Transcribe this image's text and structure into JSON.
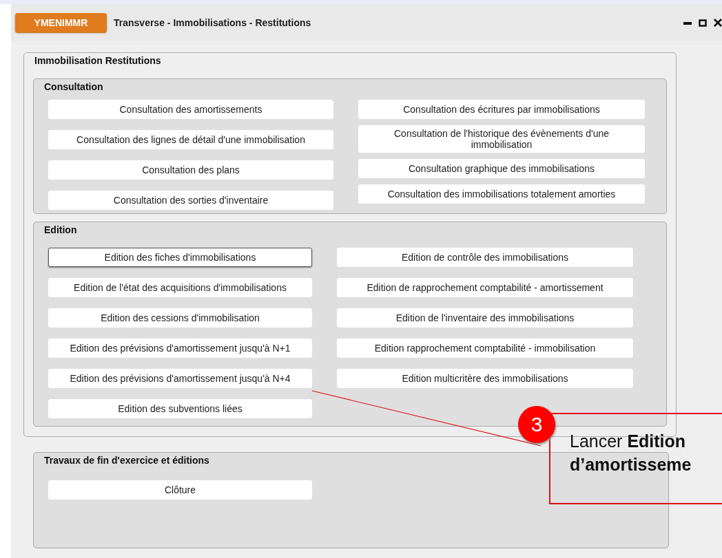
{
  "window": {
    "code": "YMENIMMR",
    "title": "Transverse - Immobilisations - Restitutions"
  },
  "panel": {
    "title": "Immobilisation Restitutions",
    "groups": [
      {
        "title": "Consultation",
        "left": [
          {
            "label": "Consultation des amortissements",
            "focused": false
          },
          {
            "label": "Consultation des lignes de détail d'une immobilisation",
            "focused": false
          },
          {
            "label": "Consultation des plans",
            "focused": false
          },
          {
            "label": "Consultation des sorties d'inventaire",
            "focused": false
          }
        ],
        "right": [
          {
            "label": "Consultation des écritures par immobilisations",
            "focused": false
          },
          {
            "label": "Consultation de l'historique des évènements d'une immobilisation",
            "focused": false
          },
          {
            "label": "Consultation graphique des immobilisations",
            "focused": false
          },
          {
            "label": "Consultation des immobilisations totalement amorties",
            "focused": false
          }
        ]
      },
      {
        "title": "Edition",
        "left": [
          {
            "label": "Edition des fiches d'immobilisations",
            "focused": true
          },
          {
            "label": "Edition de l'état des acquisitions d'immobilisations",
            "focused": false
          },
          {
            "label": "Edition des cessions d'immobilisation",
            "focused": false
          },
          {
            "label": "Edition des prévisions d'amortissement jusqu'à N+1",
            "focused": false
          },
          {
            "label": "Edition des prévisions d'amortissement jusqu'à N+4",
            "focused": false
          },
          {
            "label": "Edition des subventions liées",
            "focused": false
          }
        ],
        "right": [
          {
            "label": "Edition de contrôle des immobilisations",
            "focused": false
          },
          {
            "label": "Edition de rapprochement comptabilité - amortissement",
            "focused": false
          },
          {
            "label": "Edition de l'inventaire des immobilisations",
            "focused": false
          },
          {
            "label": "Edition rapprochement comptabilité - immobilisation",
            "focused": false
          },
          {
            "label": "Edition multicritère des immobilisations",
            "focused": false
          }
        ]
      }
    ]
  },
  "outer_groups": [
    {
      "title": "Travaux de fin d'exercice et éditions",
      "left": [
        {
          "label": "Clôture",
          "focused": false
        }
      ]
    }
  ],
  "callout": {
    "step": "3",
    "lines": [
      "Lancer **Edition**",
      "**d’amortisseme**"
    ]
  }
}
